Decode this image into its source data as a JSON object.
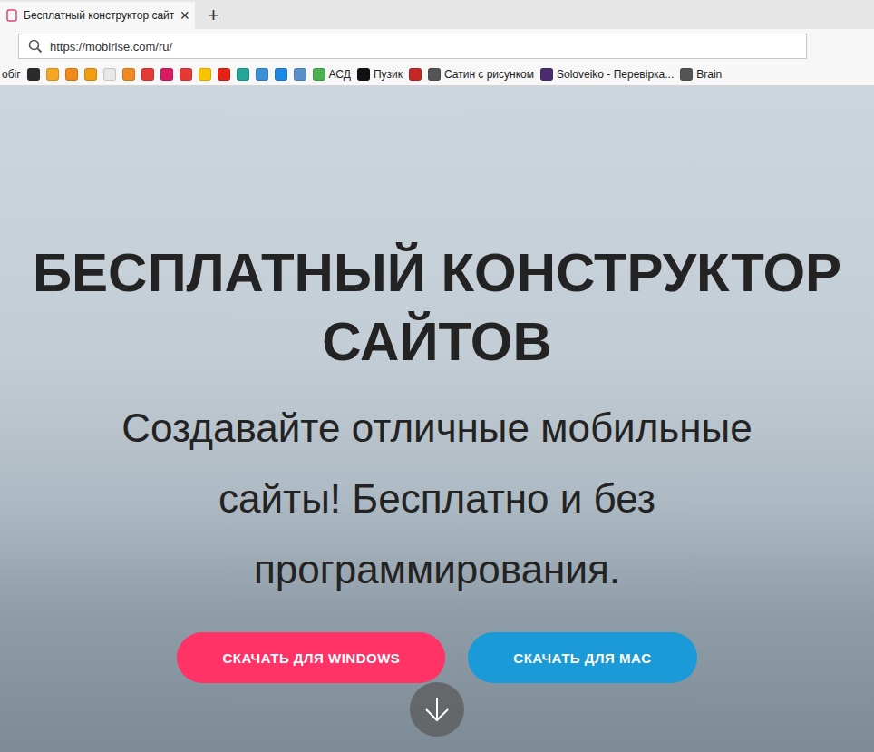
{
  "tab": {
    "title": "Бесплатный конструктор сайт",
    "close": "×",
    "selected": true
  },
  "new_tab": "+",
  "address_bar": {
    "url": "https://mobirise.com/ru/"
  },
  "bookmarks": [
    {
      "kind": "text",
      "label": "обіг"
    },
    {
      "kind": "icon",
      "color": "#2b2b2b"
    },
    {
      "kind": "icon",
      "color": "#f5a623"
    },
    {
      "kind": "icon",
      "color": "#f08a1c"
    },
    {
      "kind": "icon",
      "color": "#f39c12"
    },
    {
      "kind": "icon",
      "color": "#e8e8e8"
    },
    {
      "kind": "icon",
      "color": "#f0891f"
    },
    {
      "kind": "icon",
      "color": "#e53935"
    },
    {
      "kind": "icon",
      "color": "#d81b60"
    },
    {
      "kind": "icon",
      "color": "#e53935"
    },
    {
      "kind": "icon",
      "color": "#f9c400"
    },
    {
      "kind": "icon",
      "color": "#e62117"
    },
    {
      "kind": "icon",
      "color": "#26a69a"
    },
    {
      "kind": "icon",
      "color": "#3d8fd6"
    },
    {
      "kind": "icon",
      "color": "#1e88e5"
    },
    {
      "kind": "icon",
      "color": "#5b8fc9"
    },
    {
      "kind": "link",
      "label": "АСД",
      "color": "#4caf50"
    },
    {
      "kind": "link",
      "label": "Пузик",
      "color": "#111111"
    },
    {
      "kind": "icon",
      "color": "#c62828"
    },
    {
      "kind": "link",
      "label": "Сатин с рисунком",
      "color": "#555555"
    },
    {
      "kind": "link",
      "label": "Soloveiko - Перевірка...",
      "color": "#4a2c6e"
    },
    {
      "kind": "link",
      "label": "Brain",
      "color": "#555555"
    }
  ],
  "hero": {
    "title": "БЕСПЛАТНЫЙ КОНСТРУКТОР САЙТОВ",
    "subtitle": "Создавайте отличные мобильные сайты! Бесплатно и без программирования.",
    "buttons": [
      {
        "label": "СКАЧАТЬ ДЛЯ WINDOWS",
        "color": "#ff3366"
      },
      {
        "label": "СКАЧАТЬ ДЛЯ MAC",
        "color": "#1a9ad6"
      }
    ]
  }
}
